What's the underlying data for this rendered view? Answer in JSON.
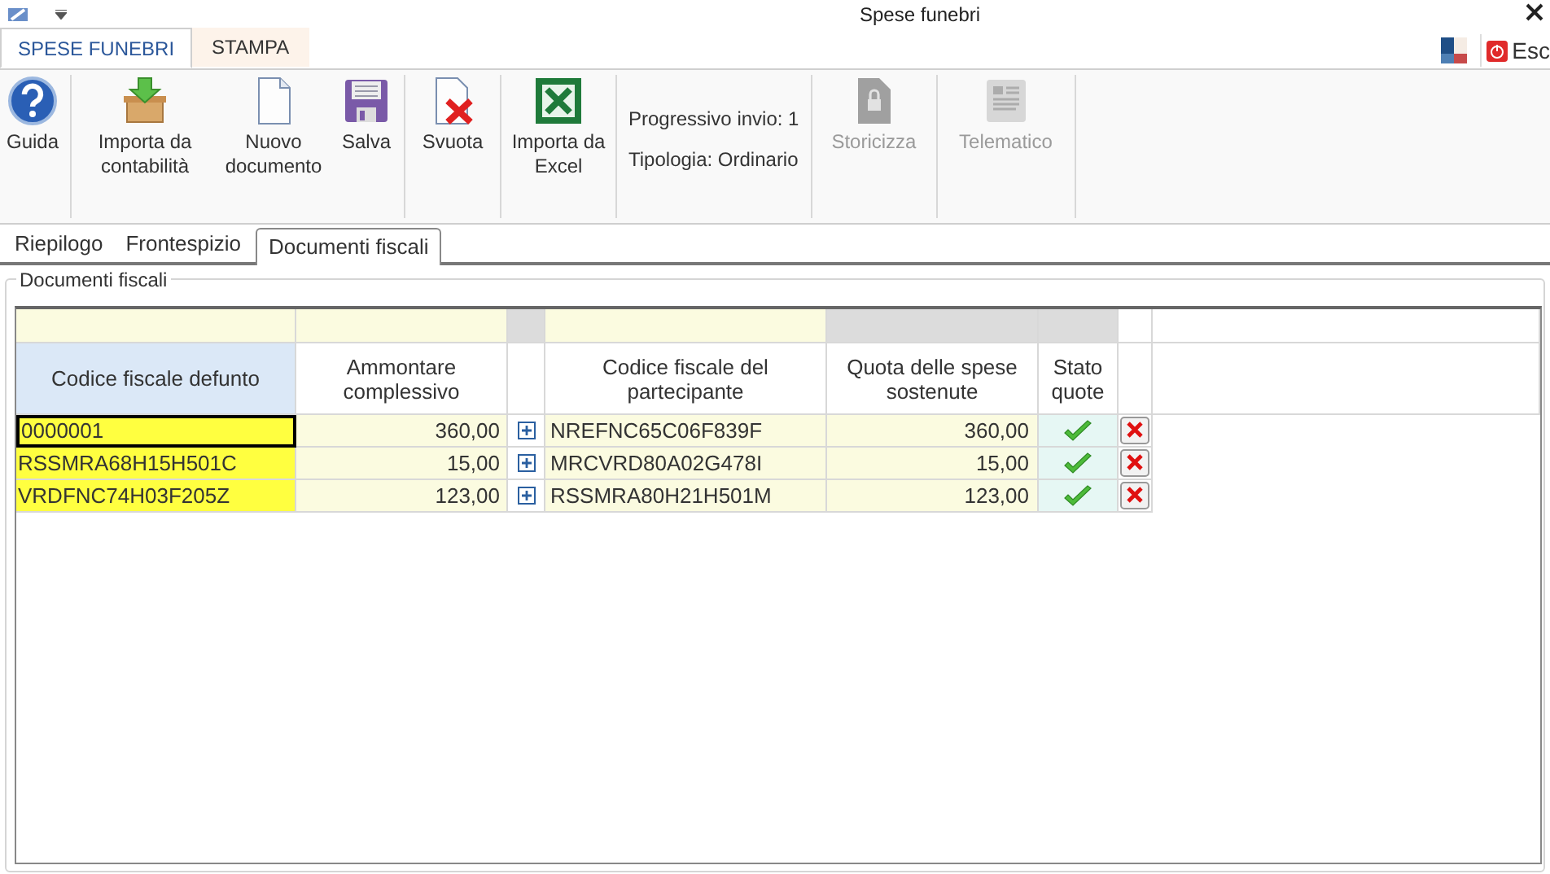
{
  "window": {
    "title": "Spese funebri"
  },
  "ribbon_tabs": [
    {
      "label": "SPESE FUNEBRI",
      "selected": true
    },
    {
      "label": "STAMPA",
      "selected": false
    }
  ],
  "exit_button": {
    "label": "Esc"
  },
  "ribbon_buttons": [
    {
      "kind": "help",
      "label": "Guida",
      "disabled": false
    },
    {
      "kind": "import",
      "label": "Importa da contabilità",
      "disabled": false
    },
    {
      "kind": "document",
      "label": "Nuovo documento",
      "disabled": false
    },
    {
      "kind": "save",
      "label": "Salva",
      "disabled": false
    },
    {
      "kind": "clear",
      "label": "Svuota",
      "disabled": false
    },
    {
      "kind": "excel",
      "label": "Importa da Excel",
      "disabled": false
    },
    {
      "kind": "info",
      "lines": [
        "Progressivo invio: 1",
        "Tipologia: Ordinario"
      ]
    },
    {
      "kind": "lock",
      "label": "Storicizza",
      "disabled": true
    },
    {
      "kind": "telematic",
      "label": "Telematico",
      "disabled": true
    }
  ],
  "tabs": [
    {
      "label": "Riepilogo",
      "selected": false
    },
    {
      "label": "Frontespizio",
      "selected": false
    },
    {
      "label": "Documenti fiscali",
      "selected": true
    }
  ],
  "group_title": "Documenti fiscali",
  "table": {
    "columns": [
      "Codice fiscale defunto",
      "Ammontare complessivo",
      "Codice fiscale del partecipante",
      "Quota delle spese sostenute",
      "Stato quote"
    ],
    "rows": [
      {
        "defunto": "0000001",
        "ammontare": "360,00",
        "partecipante": "NREFNC65C06F839F",
        "quota": "360,00",
        "ok": true,
        "selected": true
      },
      {
        "defunto": "RSSMRA68H15H501C",
        "ammontare": "15,00",
        "partecipante": "MRCVRD80A02G478I",
        "quota": "15,00",
        "ok": true,
        "selected": false
      },
      {
        "defunto": "VRDFNC74H03F205Z",
        "ammontare": "123,00",
        "partecipante": "RSSMRA80H21H501M",
        "quota": "123,00",
        "ok": true,
        "selected": false
      }
    ]
  }
}
